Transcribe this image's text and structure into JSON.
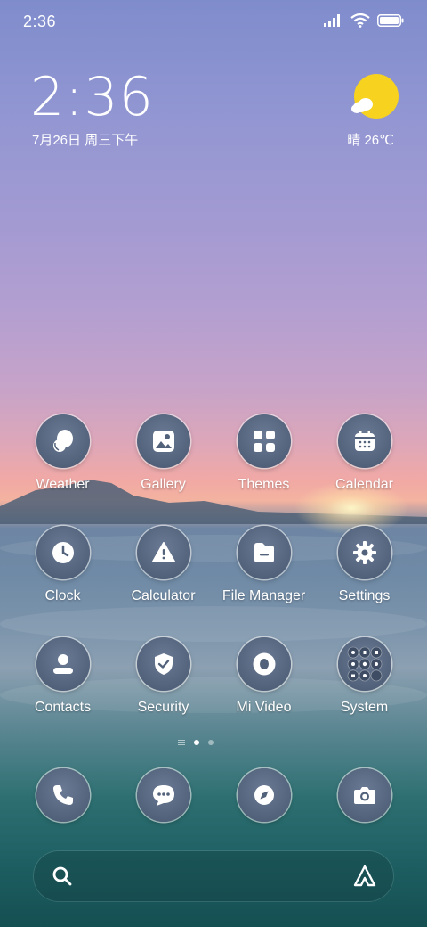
{
  "status_bar": {
    "time": "2:36"
  },
  "clock_widget": {
    "time": "2:36",
    "date": "7月26日 周三下午"
  },
  "weather_widget": {
    "text": "晴 26℃"
  },
  "apps": [
    {
      "label": "Weather",
      "icon": "weather-icon"
    },
    {
      "label": "Gallery",
      "icon": "gallery-icon"
    },
    {
      "label": "Themes",
      "icon": "themes-icon"
    },
    {
      "label": "Calendar",
      "icon": "calendar-icon"
    },
    {
      "label": "Clock",
      "icon": "clock-icon"
    },
    {
      "label": "Calculator",
      "icon": "calculator-icon"
    },
    {
      "label": "File Manager",
      "icon": "file-manager-icon"
    },
    {
      "label": "Settings",
      "icon": "settings-icon"
    },
    {
      "label": "Contacts",
      "icon": "contacts-icon"
    },
    {
      "label": "Security",
      "icon": "security-icon"
    },
    {
      "label": "Mi Video",
      "icon": "mi-video-icon"
    },
    {
      "label": "System",
      "icon": "system-folder-icon"
    }
  ],
  "dock": [
    {
      "icon": "phone-icon"
    },
    {
      "icon": "messages-icon"
    },
    {
      "icon": "browser-icon"
    },
    {
      "icon": "camera-icon"
    }
  ],
  "colors": {
    "icon_bg": "#52627b",
    "icon_glyph": "#ffffff",
    "sun": "#f7d21e"
  }
}
